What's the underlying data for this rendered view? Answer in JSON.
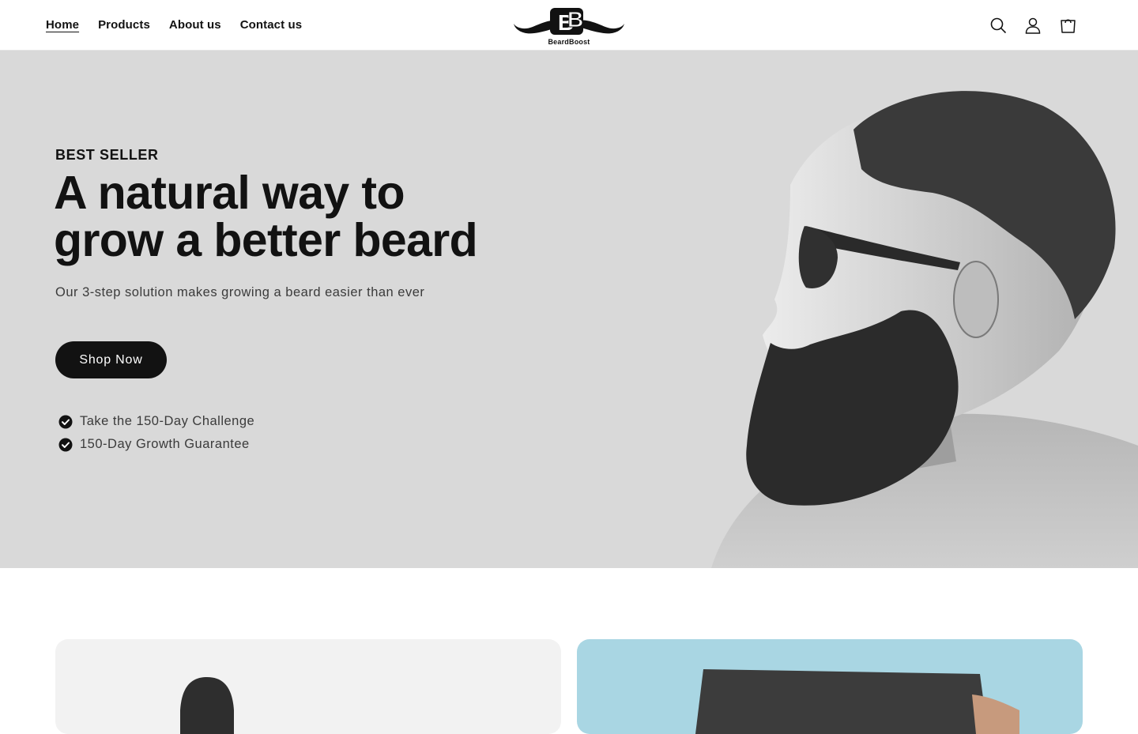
{
  "header": {
    "nav": [
      {
        "label": "Home",
        "active": true
      },
      {
        "label": "Products",
        "active": false
      },
      {
        "label": "About us",
        "active": false
      },
      {
        "label": "Contact us",
        "active": false
      }
    ],
    "logo_text": "BeardBoost",
    "icons": [
      "search-icon",
      "account-icon",
      "cart-icon"
    ]
  },
  "hero": {
    "eyebrow": "BEST SELLER",
    "headline_line1": "A natural way to",
    "headline_line2": "grow a better beard",
    "subtext": "Our 3-step solution makes growing a beard easier than ever",
    "cta_label": "Shop Now",
    "checks": [
      "Take the 150-Day Challenge",
      "150-Day Growth Guarantee"
    ],
    "background_color": "#d9d9d9"
  },
  "colors": {
    "primary": "#121212",
    "text_muted": "#3b3b3b",
    "card_left_bg": "#f2f2f2",
    "card_right_bg": "#a9d6e3"
  }
}
